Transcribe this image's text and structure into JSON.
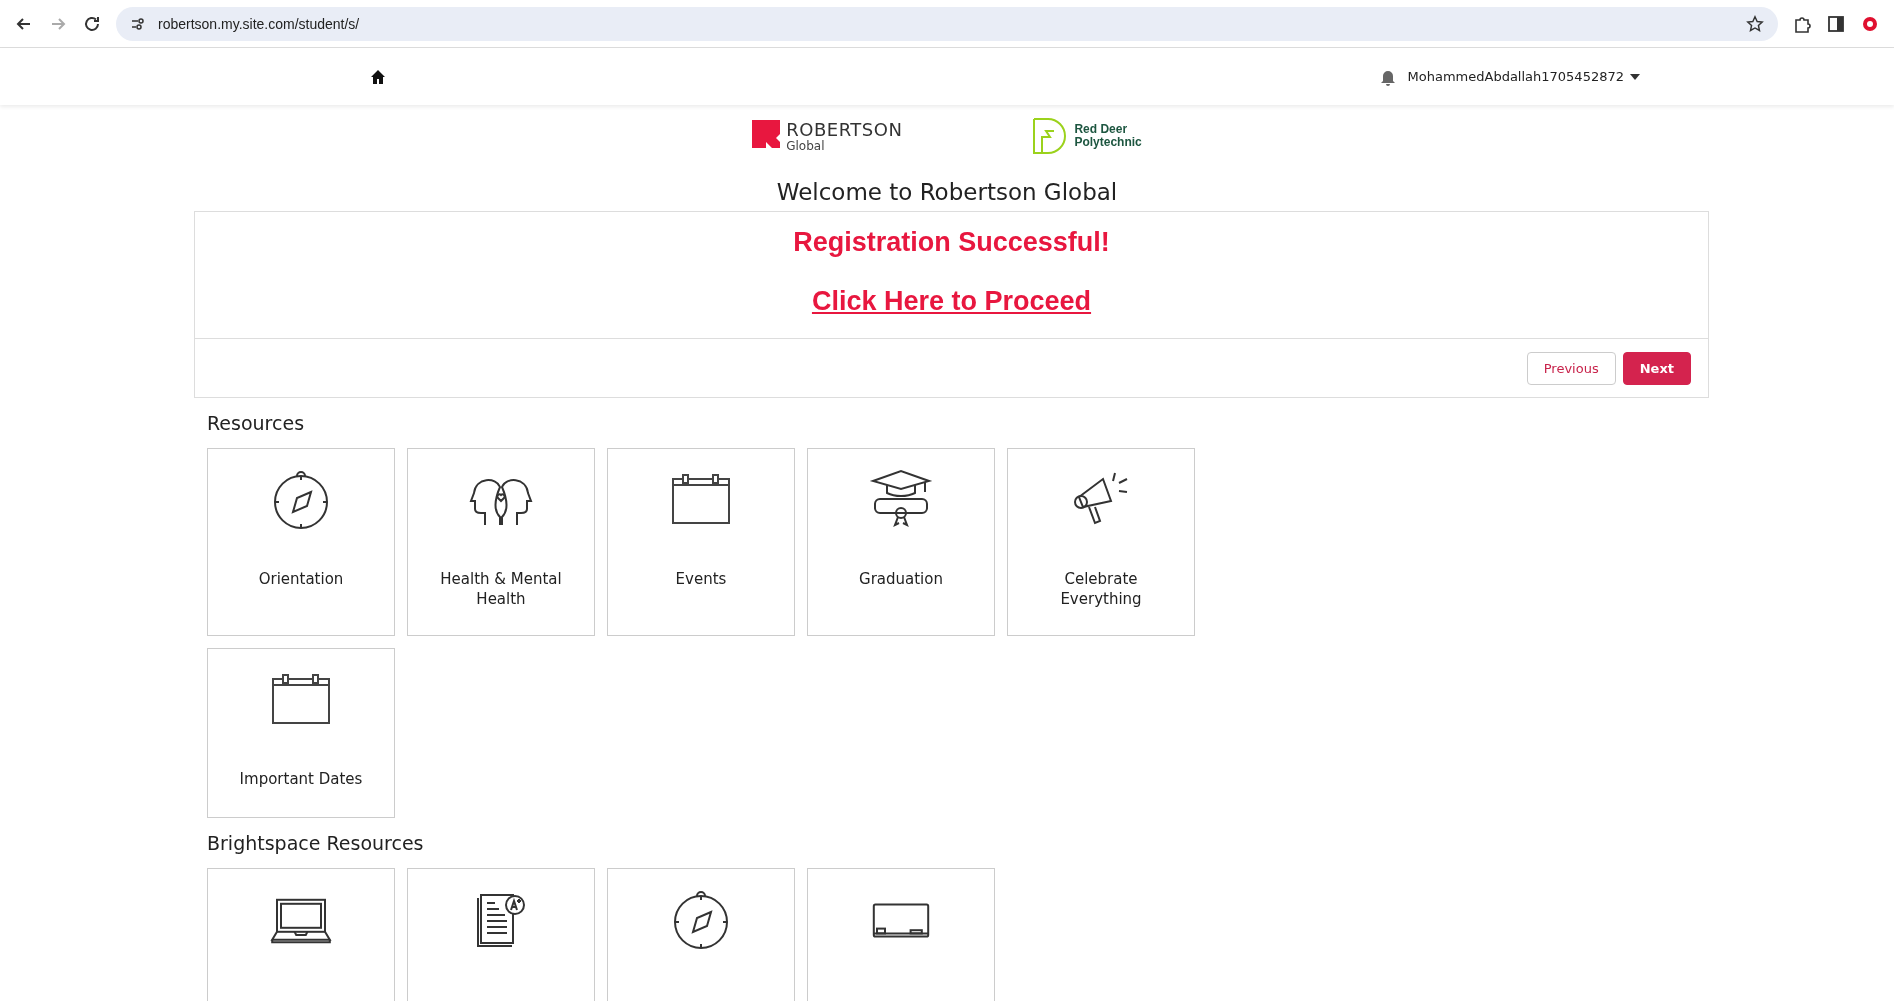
{
  "browser": {
    "url": "robertson.my.site.com/student/s/",
    "forward_disabled": true
  },
  "header": {
    "username": "MohammedAbdallah1705452872"
  },
  "logos": {
    "primary": {
      "name": "ROBERTSON",
      "sub": "Global"
    },
    "partner": {
      "line1": "Red Deer",
      "line2": "Polytechnic"
    }
  },
  "title": "Welcome to Robertson Global",
  "card": {
    "heading": "Registration Successful!",
    "link": "Click Here to Proceed",
    "buttons": [
      {
        "label": "Previous",
        "kind": "secondary"
      },
      {
        "label": "Next",
        "kind": "primary"
      }
    ]
  },
  "sections": [
    {
      "heading": "Resources",
      "tiles": [
        {
          "label": "Orientation",
          "kind": "compass"
        },
        {
          "label": "Health & Mental Health",
          "kind": "heads"
        },
        {
          "label": "Events",
          "kind": "calendar"
        },
        {
          "label": "Graduation",
          "kind": "graduation"
        },
        {
          "label": "Celebrate Everything",
          "kind": "megaphone"
        },
        {
          "label": "Important Dates",
          "kind": "calendar"
        }
      ]
    },
    {
      "heading": "Brightspace Resources",
      "tiles": [
        {
          "kind": "laptop"
        },
        {
          "kind": "document"
        },
        {
          "kind": "compass"
        },
        {
          "kind": "board"
        }
      ]
    }
  ]
}
